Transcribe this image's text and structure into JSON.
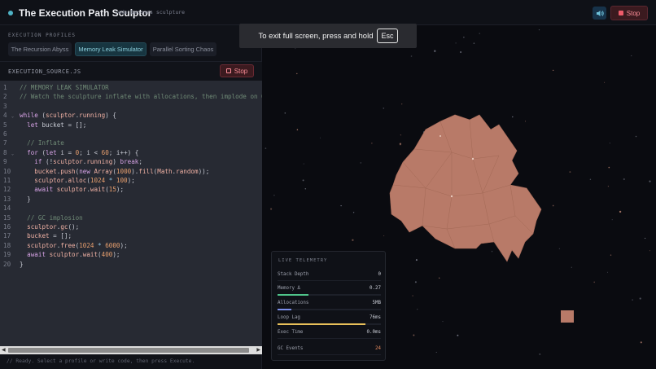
{
  "header": {
    "title": "The Execution Path Sculptor",
    "tagline": "code becomes sculpture",
    "stop_label": "Stop",
    "accent": "#4fb3c6"
  },
  "profiles": {
    "section_label": "EXECUTION PROFILES",
    "tabs": [
      {
        "label": "The Recursion Abyss",
        "active": false
      },
      {
        "label": "Memory Leak Simulator",
        "active": true
      },
      {
        "label": "Parallel Sorting Chaos",
        "active": false
      }
    ]
  },
  "source": {
    "filename": "EXECUTION_SOURCE.JS",
    "stop_label": "Stop"
  },
  "code_lines": [
    [
      {
        "t": "// MEMORY LEAK SIMULATOR",
        "c": "comment"
      }
    ],
    [
      {
        "t": "// Watch the sculpture inflate with allocations, then implode on GC",
        "c": "comment"
      }
    ],
    [],
    [
      {
        "t": "while",
        "c": "kw"
      },
      {
        "t": " (",
        "c": "punc"
      },
      {
        "t": "sculptor",
        "c": "fn"
      },
      {
        "t": ".",
        "c": "punc"
      },
      {
        "t": "running",
        "c": "fn"
      },
      {
        "t": ") {",
        "c": "punc"
      }
    ],
    [
      {
        "t": "  ",
        "c": "punc"
      },
      {
        "t": "let",
        "c": "kw"
      },
      {
        "t": " bucket = [];",
        "c": "var"
      }
    ],
    [],
    [
      {
        "t": "  // Inflate",
        "c": "comment"
      }
    ],
    [
      {
        "t": "  ",
        "c": "punc"
      },
      {
        "t": "for",
        "c": "kw"
      },
      {
        "t": " (",
        "c": "punc"
      },
      {
        "t": "let",
        "c": "kw"
      },
      {
        "t": " i = ",
        "c": "var"
      },
      {
        "t": "0",
        "c": "num"
      },
      {
        "t": "; i < ",
        "c": "var"
      },
      {
        "t": "60",
        "c": "num"
      },
      {
        "t": "; i++) {",
        "c": "var"
      }
    ],
    [
      {
        "t": "    ",
        "c": "punc"
      },
      {
        "t": "if",
        "c": "kw"
      },
      {
        "t": " (!",
        "c": "punc"
      },
      {
        "t": "sculptor",
        "c": "fn"
      },
      {
        "t": ".",
        "c": "punc"
      },
      {
        "t": "running",
        "c": "fn"
      },
      {
        "t": ") ",
        "c": "punc"
      },
      {
        "t": "break",
        "c": "kw"
      },
      {
        "t": ";",
        "c": "punc"
      }
    ],
    [
      {
        "t": "    ",
        "c": "punc"
      },
      {
        "t": "bucket",
        "c": "fn"
      },
      {
        "t": ".",
        "c": "punc"
      },
      {
        "t": "push",
        "c": "fn"
      },
      {
        "t": "(",
        "c": "punc"
      },
      {
        "t": "new",
        "c": "kw"
      },
      {
        "t": " ",
        "c": "punc"
      },
      {
        "t": "Array",
        "c": "fn"
      },
      {
        "t": "(",
        "c": "punc"
      },
      {
        "t": "1000",
        "c": "num"
      },
      {
        "t": ").",
        "c": "punc"
      },
      {
        "t": "fill",
        "c": "fn"
      },
      {
        "t": "(",
        "c": "punc"
      },
      {
        "t": "Math",
        "c": "fn"
      },
      {
        "t": ".",
        "c": "punc"
      },
      {
        "t": "random",
        "c": "fn"
      },
      {
        "t": "));",
        "c": "punc"
      }
    ],
    [
      {
        "t": "    ",
        "c": "punc"
      },
      {
        "t": "sculptor",
        "c": "fn"
      },
      {
        "t": ".",
        "c": "punc"
      },
      {
        "t": "alloc",
        "c": "fn"
      },
      {
        "t": "(",
        "c": "punc"
      },
      {
        "t": "1024",
        "c": "num"
      },
      {
        "t": " * ",
        "c": "op"
      },
      {
        "t": "100",
        "c": "num"
      },
      {
        "t": ");",
        "c": "punc"
      }
    ],
    [
      {
        "t": "    ",
        "c": "punc"
      },
      {
        "t": "await",
        "c": "kw"
      },
      {
        "t": " ",
        "c": "punc"
      },
      {
        "t": "sculptor",
        "c": "fn"
      },
      {
        "t": ".",
        "c": "punc"
      },
      {
        "t": "wait",
        "c": "fn"
      },
      {
        "t": "(",
        "c": "punc"
      },
      {
        "t": "15",
        "c": "num"
      },
      {
        "t": ");",
        "c": "punc"
      }
    ],
    [
      {
        "t": "  }",
        "c": "punc"
      }
    ],
    [],
    [
      {
        "t": "  // GC implosion",
        "c": "comment"
      }
    ],
    [
      {
        "t": "  ",
        "c": "punc"
      },
      {
        "t": "sculptor",
        "c": "fn"
      },
      {
        "t": ".",
        "c": "punc"
      },
      {
        "t": "gc",
        "c": "fn"
      },
      {
        "t": "();",
        "c": "punc"
      }
    ],
    [
      {
        "t": "  ",
        "c": "punc"
      },
      {
        "t": "bucket",
        "c": "fn"
      },
      {
        "t": " = [];",
        "c": "punc"
      }
    ],
    [
      {
        "t": "  ",
        "c": "punc"
      },
      {
        "t": "sculptor",
        "c": "fn"
      },
      {
        "t": ".",
        "c": "punc"
      },
      {
        "t": "free",
        "c": "fn"
      },
      {
        "t": "(",
        "c": "punc"
      },
      {
        "t": "1024",
        "c": "num"
      },
      {
        "t": " * ",
        "c": "op"
      },
      {
        "t": "6000",
        "c": "num"
      },
      {
        "t": ");",
        "c": "punc"
      }
    ],
    [
      {
        "t": "  ",
        "c": "punc"
      },
      {
        "t": "await",
        "c": "kw"
      },
      {
        "t": " ",
        "c": "punc"
      },
      {
        "t": "sculptor",
        "c": "fn"
      },
      {
        "t": ".",
        "c": "punc"
      },
      {
        "t": "wait",
        "c": "fn"
      },
      {
        "t": "(",
        "c": "punc"
      },
      {
        "t": "400",
        "c": "num"
      },
      {
        "t": ");",
        "c": "punc"
      }
    ],
    [
      {
        "t": "}",
        "c": "punc"
      }
    ]
  ],
  "fold_lines": [
    4,
    8
  ],
  "console_text": "// Ready. Select a profile or write code, then press Execute.",
  "fullscreen_notice": {
    "message": "To exit full screen, press and hold",
    "key": "Esc"
  },
  "telemetry": {
    "title": "LIVE TELEMETRY",
    "metrics": [
      {
        "label": "Stack Depth",
        "value": "0",
        "level": 0,
        "color": "#4fb3c6"
      },
      {
        "label": "Memory Δ",
        "value": "0.27",
        "level": 0.3,
        "color": "#4fc48a"
      },
      {
        "label": "Allocations",
        "value": "5MB",
        "level": 0.13,
        "color": "#7b8ee8"
      },
      {
        "label": "Loop Lag",
        "value": "76ms",
        "level": 0.85,
        "color": "#e8c05a"
      },
      {
        "label": "Exec Time",
        "value": "0.0ms",
        "level": 0,
        "color": "#4fb3c6"
      },
      {
        "label": "GC Events",
        "value": "24",
        "level": 0,
        "color": "#e58a5f"
      }
    ]
  },
  "colors": {
    "sculpture": "#b87a68",
    "stop": "#ef5b6a"
  }
}
